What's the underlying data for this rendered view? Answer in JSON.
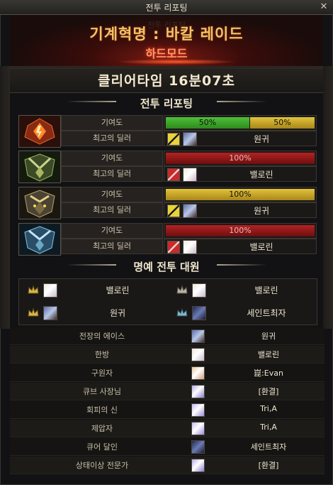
{
  "window": {
    "title": "전투 리포팅",
    "close_icon": "x-icon"
  },
  "banner": {
    "raid_name": "기계혁명 : 바칼 레이드",
    "difficulty": "하드모드",
    "shadow_text": "전투 리포팅"
  },
  "clear_time": "클리어타임  16분07초",
  "sections": {
    "battle_report": "전투 리포팅",
    "honor_members": "명예 전투 대원"
  },
  "bosses": [
    {
      "contribution_label": "기여도",
      "dealer_label": "최고의 딜러",
      "bars": [
        {
          "label": "50%",
          "value": 50,
          "color": "#3aa52a"
        },
        {
          "label": "50%",
          "value": 50,
          "color": "#c9a92a"
        }
      ],
      "dealer_name": "원귀",
      "dealer_chip": "yellow"
    },
    {
      "contribution_label": "기여도",
      "dealer_label": "최고의 딜러",
      "bars": [
        {
          "label": "100%",
          "value": 100,
          "color": "#9a1c1c"
        }
      ],
      "dealer_name": "밸로린",
      "dealer_chip": "red"
    },
    {
      "contribution_label": "기여도",
      "dealer_label": "최고의 딜러",
      "bars": [
        {
          "label": "100%",
          "value": 100,
          "color": "#c9a92a"
        }
      ],
      "dealer_name": "원귀",
      "dealer_chip": "yellow"
    },
    {
      "contribution_label": "기여도",
      "dealer_label": "최고의 딜러",
      "bars": [
        {
          "label": "100%",
          "value": 100,
          "color": "#9a1c1c"
        }
      ],
      "dealer_name": "밸로린",
      "dealer_chip": "red"
    }
  ],
  "honor": [
    {
      "name": "밸로린"
    },
    {
      "name": "밸로린"
    },
    {
      "name": "원귀"
    },
    {
      "name": "세인트최자"
    }
  ],
  "awards": [
    {
      "title": "전장의 에이스",
      "player": "원귀"
    },
    {
      "title": "한방",
      "player": "밸로린"
    },
    {
      "title": "구원자",
      "player": "崑:Evan"
    },
    {
      "title": "큐브 사장님",
      "player": "[환결]"
    },
    {
      "title": "회피의 신",
      "player": "Tri,A"
    },
    {
      "title": "제압자",
      "player": "Tri,A"
    },
    {
      "title": "큐어 달인",
      "player": "세인트최자"
    },
    {
      "title": "상태이상 전문가",
      "player": "[환결]"
    }
  ]
}
